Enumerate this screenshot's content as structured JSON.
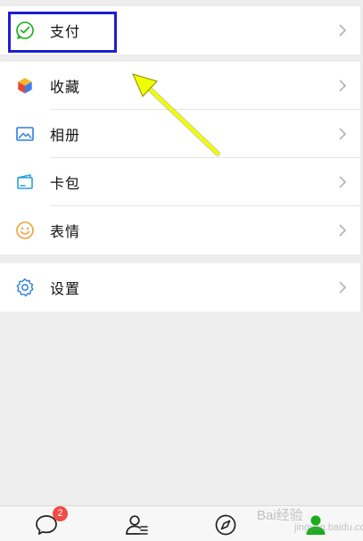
{
  "menu": {
    "pay": {
      "label": "支付",
      "icon": "wechat-pay-icon"
    },
    "items": [
      {
        "label": "收藏",
        "icon": "favorites-cube-icon"
      },
      {
        "label": "相册",
        "icon": "album-icon"
      },
      {
        "label": "卡包",
        "icon": "card-wallet-icon"
      },
      {
        "label": "表情",
        "icon": "smiley-icon"
      }
    ],
    "settings": {
      "label": "设置",
      "icon": "gear-icon"
    }
  },
  "tabbar": {
    "tabs": [
      {
        "icon": "chat-icon"
      },
      {
        "icon": "contacts-icon"
      },
      {
        "icon": "discover-compass-icon"
      },
      {
        "icon": "me-icon"
      }
    ],
    "chat_badge": "2"
  },
  "watermark": {
    "text": "Bai经验",
    "sub": "jingyan.baidu.com"
  },
  "colors": {
    "background": "#ededed",
    "highlight": "#1e1ed0",
    "arrow": "#f0ff00",
    "active_tab": "#1aad19",
    "badge": "#f04b45"
  }
}
